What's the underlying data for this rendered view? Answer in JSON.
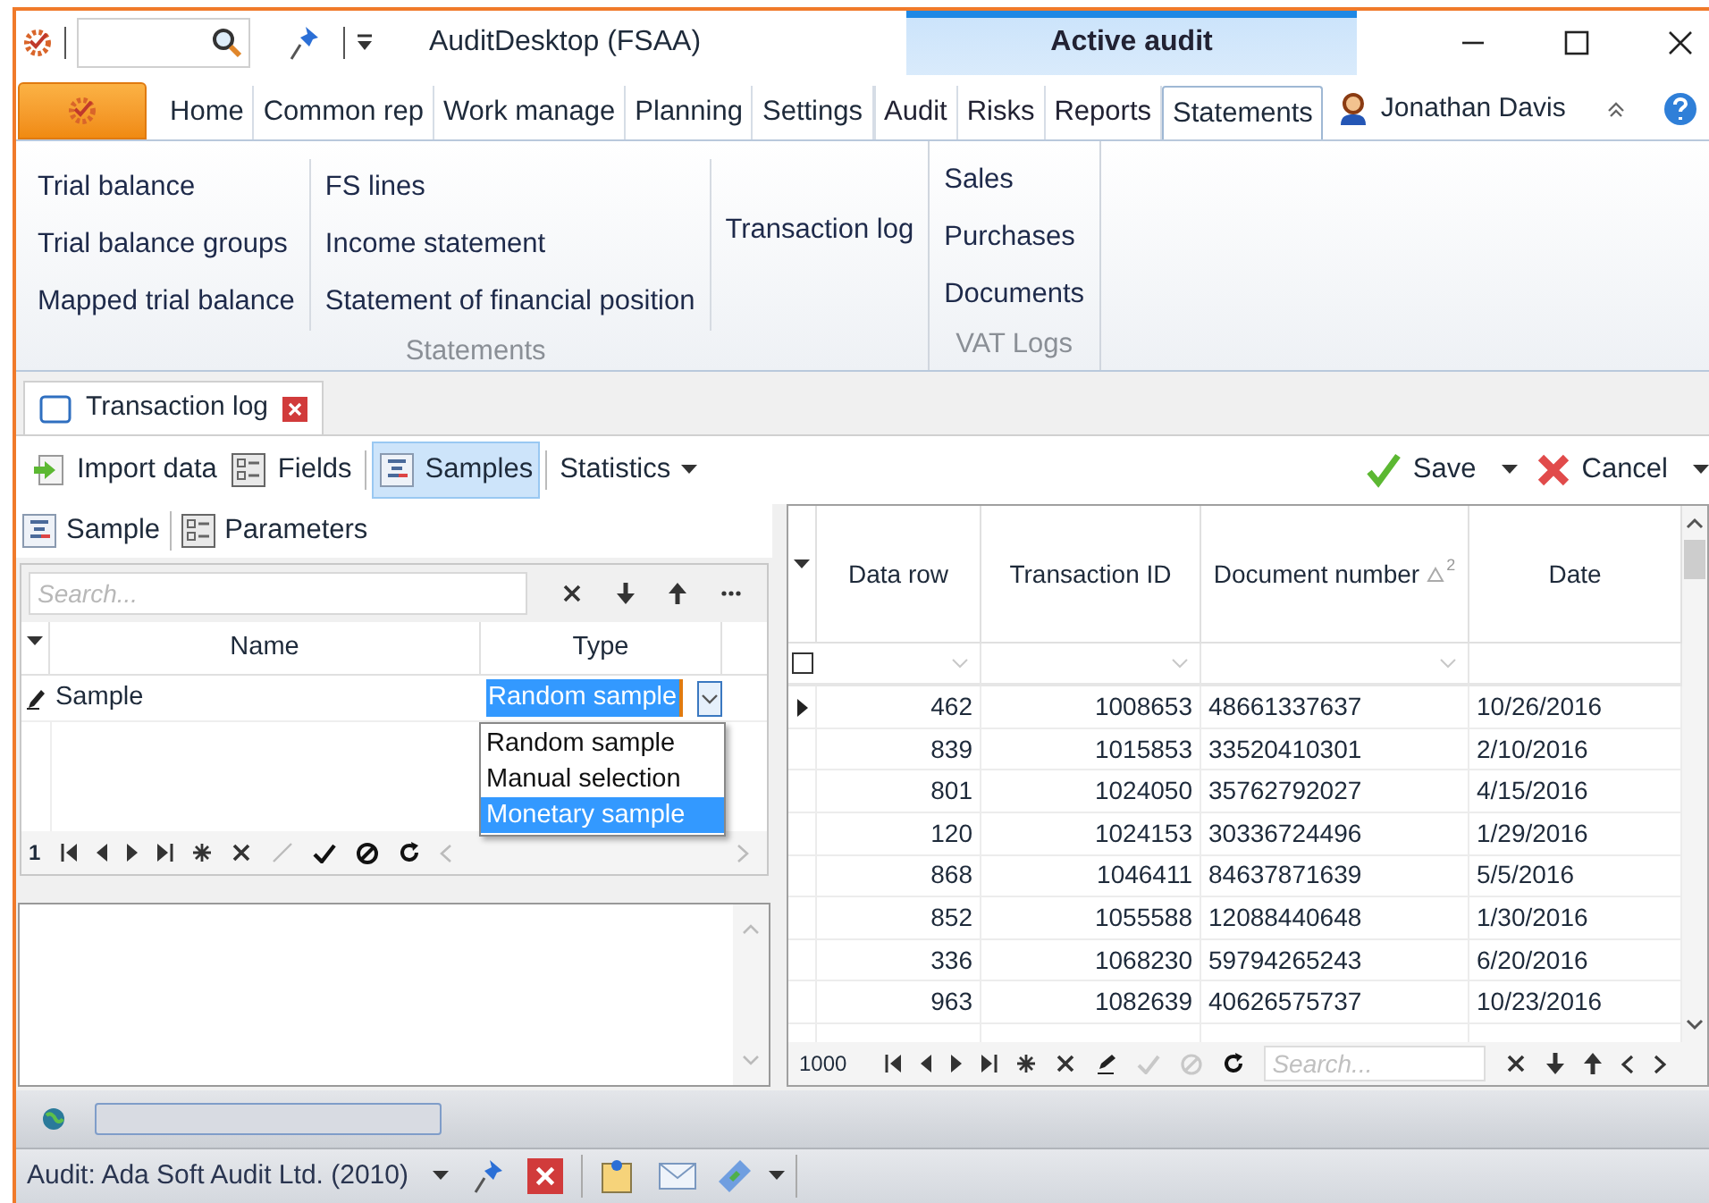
{
  "window": {
    "title": "AuditDesktop (FSAA)",
    "context_group": "Active audit"
  },
  "ribbon_tabs": [
    {
      "label": "Home",
      "selected": false,
      "context": false
    },
    {
      "label": "Common rep",
      "selected": false,
      "context": false
    },
    {
      "label": "Work manage",
      "selected": false,
      "context": false
    },
    {
      "label": "Planning",
      "selected": false,
      "context": false
    },
    {
      "label": "Settings",
      "selected": false,
      "context": false
    },
    {
      "label": "Audit",
      "selected": false,
      "context": true
    },
    {
      "label": "Risks",
      "selected": false,
      "context": true
    },
    {
      "label": "Reports",
      "selected": false,
      "context": true
    },
    {
      "label": "Statements",
      "selected": true,
      "context": true
    }
  ],
  "user": {
    "name": "Jonathan Davis"
  },
  "ribbon_groups": [
    {
      "label": "Statements",
      "columns": [
        [
          "Trial balance",
          "Trial balance groups",
          "Mapped trial balance"
        ],
        [
          "FS lines",
          "Income statement",
          "Statement of financial position"
        ],
        [
          "Transaction log"
        ]
      ]
    },
    {
      "label": "VAT Logs",
      "columns": [
        [
          "Sales",
          "Purchases",
          "Documents"
        ]
      ]
    }
  ],
  "document_tabs": [
    {
      "label": "Transaction log",
      "selected": true
    }
  ],
  "toolbar": [
    {
      "label": "Import data",
      "kind": "import",
      "selected": false
    },
    {
      "label": "Fields",
      "kind": "fields",
      "selected": false
    },
    {
      "label": "Samples",
      "kind": "samples",
      "selected": true
    },
    {
      "label": "Statistics",
      "kind": "dropdown",
      "selected": false
    }
  ],
  "actions": [
    {
      "label": "Save",
      "kind": "save"
    },
    {
      "label": "Cancel",
      "kind": "cancel"
    }
  ],
  "samples_panel": {
    "tabs": [
      {
        "label": "Sample",
        "kind": "samples"
      },
      {
        "label": "Parameters",
        "kind": "fields"
      }
    ],
    "search": {
      "placeholder": "Search..."
    },
    "columns": [
      "Name",
      "Type"
    ],
    "rows": [
      {
        "name": "Sample",
        "type": "Random sample",
        "editing": true
      }
    ],
    "type_options": [
      {
        "label": "Random sample",
        "selected": false
      },
      {
        "label": "Manual selection",
        "selected": false
      },
      {
        "label": "Monetary sample",
        "selected": true
      }
    ],
    "record_count": "1"
  },
  "transactions": {
    "columns": [
      {
        "label": "Data row"
      },
      {
        "label": "Transaction ID"
      },
      {
        "label": "Document number",
        "sort_order": "2"
      },
      {
        "label": "Date"
      }
    ],
    "filter_checkbox": {
      "checked": false
    },
    "rows": [
      {
        "current": true,
        "cells": [
          "462",
          "1008653",
          "48661337637",
          "10/26/2016"
        ]
      },
      {
        "current": false,
        "cells": [
          "839",
          "1015853",
          "33520410301",
          "2/10/2016"
        ]
      },
      {
        "current": false,
        "cells": [
          "801",
          "1024050",
          "35762792027",
          "4/15/2016"
        ]
      },
      {
        "current": false,
        "cells": [
          "120",
          "1024153",
          "30336724496",
          "1/29/2016"
        ]
      },
      {
        "current": false,
        "cells": [
          "868",
          "1046411",
          "84637871639",
          "5/5/2016"
        ]
      },
      {
        "current": false,
        "cells": [
          "852",
          "1055588",
          "12088440648",
          "1/30/2016"
        ]
      },
      {
        "current": false,
        "cells": [
          "336",
          "1068230",
          "59794265243",
          "6/20/2016"
        ]
      },
      {
        "current": false,
        "cells": [
          "963",
          "1082639",
          "40626575737",
          "10/23/2016"
        ]
      }
    ],
    "record_count": "1000",
    "search": {
      "placeholder": "Search..."
    }
  },
  "progress": {
    "level": 0
  },
  "status_bar": {
    "audit": "Audit: Ada Soft Audit Ltd. (2010)"
  }
}
